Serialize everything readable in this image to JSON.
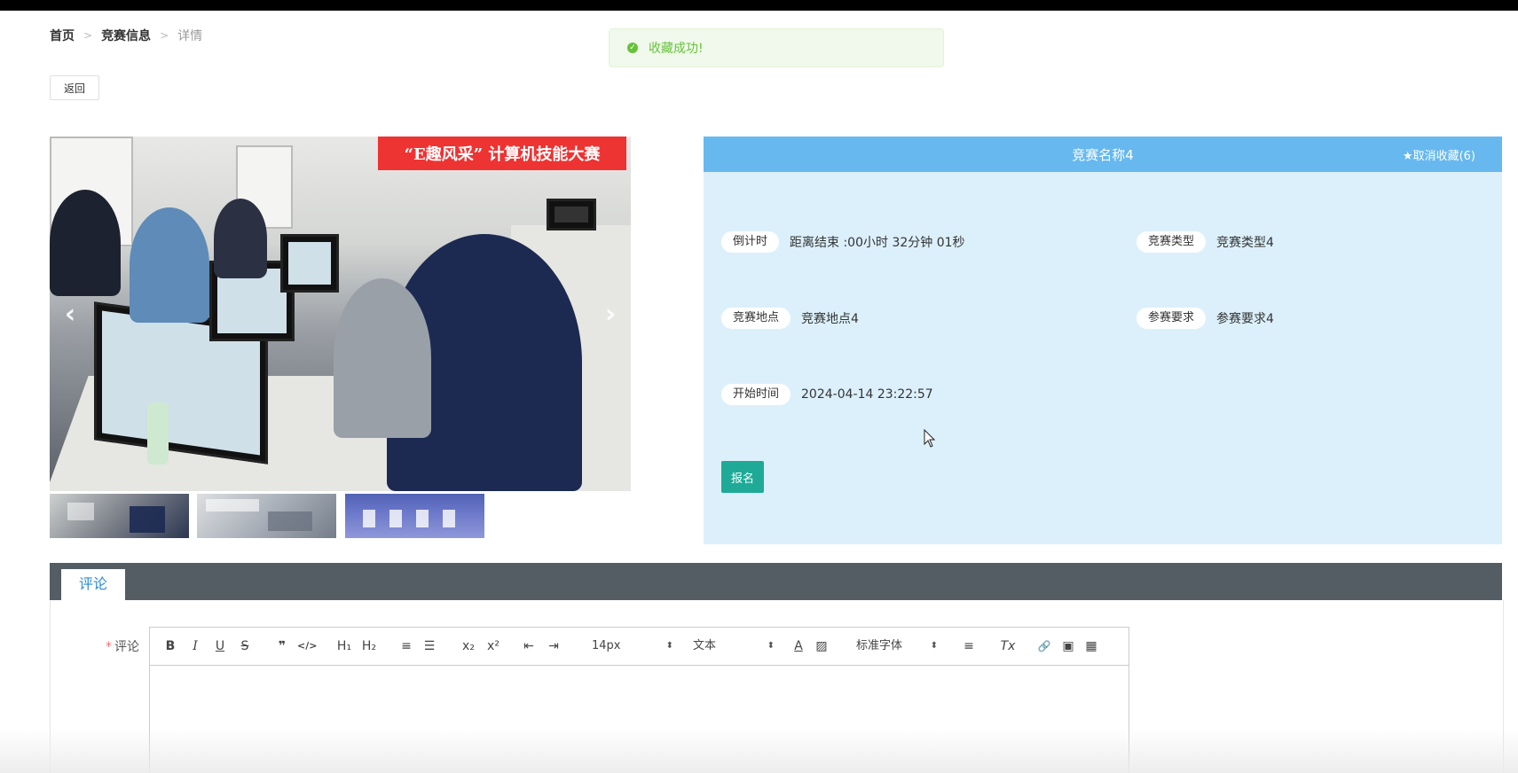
{
  "breadcrumb": {
    "home": "首页",
    "sep": ">",
    "list": "竞赛信息",
    "current": "详情"
  },
  "toast": {
    "message": "收藏成功!",
    "icon": "check-circle-icon",
    "color": "#67c23a"
  },
  "back_label": "返回",
  "carousel": {
    "banner_text": "“E趣风采” 计算机技能大赛",
    "prev": "‹",
    "next": "›"
  },
  "detail": {
    "title": "竞赛名称4",
    "favorite": "★取消收藏(6)",
    "countdown_label": "倒计时",
    "countdown_value": "距离结束 :00小时 32分钟 01秒",
    "type_label": "竞赛类型",
    "type_value": "竞赛类型4",
    "place_label": "竞赛地点",
    "place_value": "竞赛地点4",
    "req_label": "参赛要求",
    "req_value": "参赛要求4",
    "start_label": "开始时间",
    "start_value": "2024-04-14 23:22:57",
    "signup": "报名"
  },
  "tabs": {
    "comment": "评论"
  },
  "comment_form": {
    "required_mark": "*",
    "label": "评论",
    "toolbar": {
      "bold": "B",
      "italic": "I",
      "underline": "U",
      "strike": "S",
      "quote": "❞",
      "code": "</>",
      "h1": "H₁",
      "h2": "H₂",
      "ordered": "≡",
      "bullet": "☰",
      "sub": "x₂",
      "sup": "x²",
      "outdent": "⇤",
      "indent": "⇥",
      "size": "14px",
      "header": "文本",
      "font": "标准字体",
      "color": "A",
      "bg": "▨",
      "align": "≡",
      "clean": "Tx",
      "link": "🔗",
      "image": "▣",
      "video": "▦"
    }
  },
  "colors": {
    "header": "#66b8ef",
    "panel": "#dcf0fb",
    "signup": "#1eaa96",
    "tabs": "#545c64",
    "tab_text": "#2b8bd6"
  }
}
